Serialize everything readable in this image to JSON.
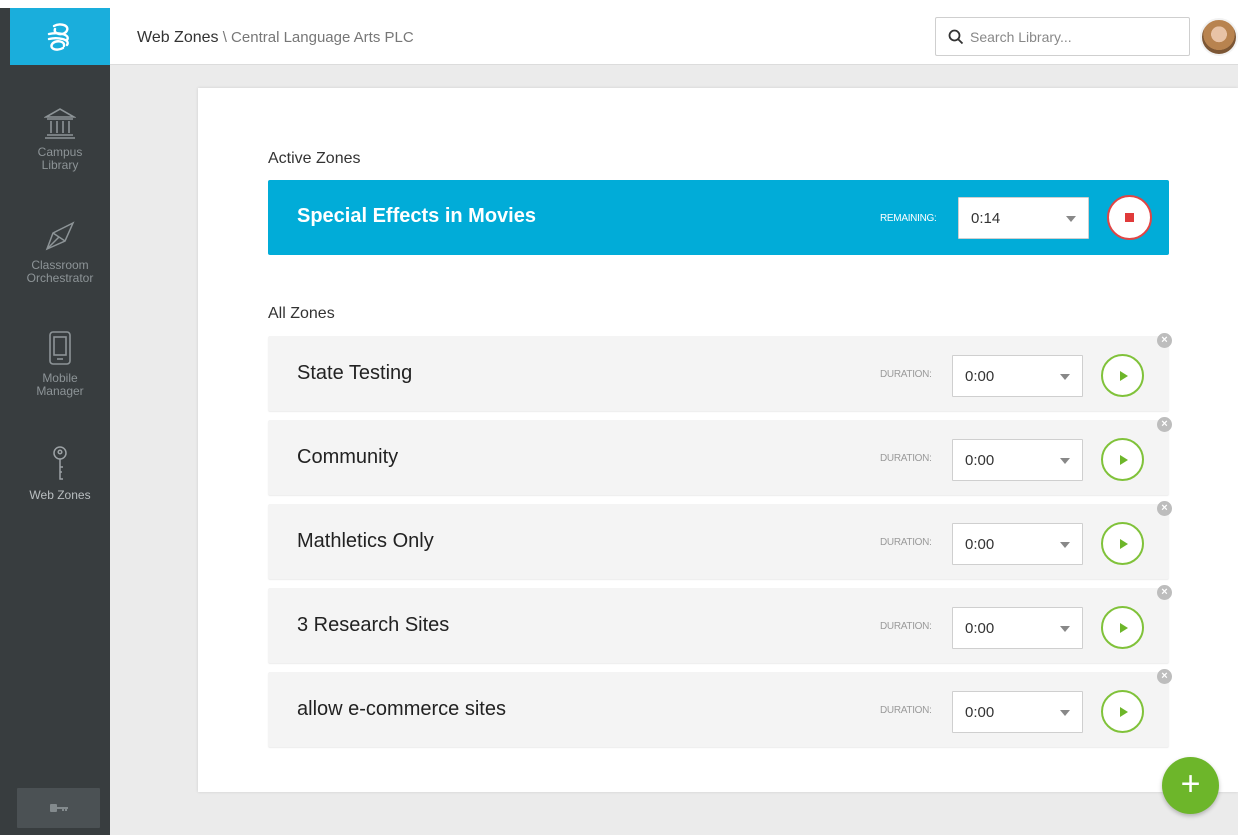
{
  "header": {
    "section": "Web Zones",
    "separator": " \\ ",
    "organization": "Central Language Arts PLC",
    "search_placeholder": "Search Library..."
  },
  "sidebar": {
    "items": [
      {
        "label": "Campus Library",
        "icon": "library-icon"
      },
      {
        "label": "Classroom Orchestrator",
        "icon": "orchestrator-icon"
      },
      {
        "label": "Mobile Manager",
        "icon": "tablet-icon"
      },
      {
        "label": "Web Zones",
        "icon": "key-icon"
      }
    ]
  },
  "active_zones": {
    "title": "Active Zones",
    "zone": {
      "name": "Special Effects in Movies",
      "label": "REMAINING:",
      "value": "0:14"
    }
  },
  "all_zones": {
    "title": "All Zones",
    "label": "DURATION:",
    "zones": [
      {
        "name": "State Testing",
        "duration": "0:00"
      },
      {
        "name": "Community",
        "duration": "0:00"
      },
      {
        "name": "Mathletics Only",
        "duration": "0:00"
      },
      {
        "name": "3 Research Sites",
        "duration": "0:00"
      },
      {
        "name": "allow e-commerce sites",
        "duration": "0:00"
      }
    ]
  },
  "fab_label": "+",
  "colors": {
    "accent": "#01acd8",
    "sidebar": "#383d3f",
    "play": "#6db62a",
    "stop": "#e03a3a"
  }
}
